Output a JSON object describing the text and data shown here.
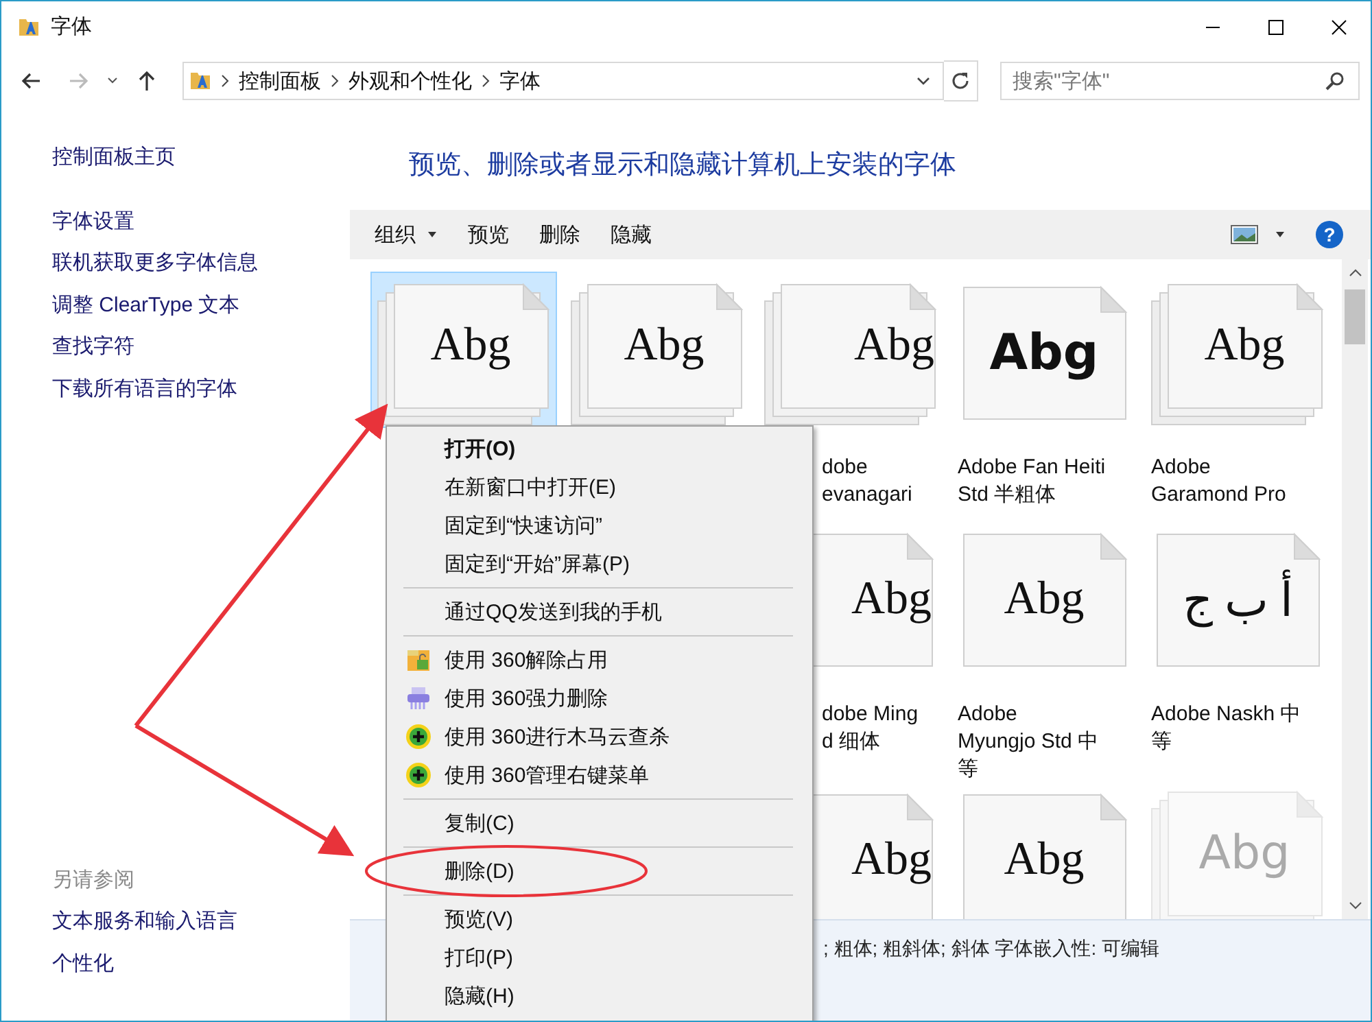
{
  "window": {
    "title": "字体"
  },
  "address": {
    "crumbs": [
      "控制面板",
      "外观和个性化",
      "字体"
    ],
    "search_placeholder": "搜索\"字体\""
  },
  "sidebar": {
    "home": "控制面板主页",
    "links": [
      "字体设置",
      "联机获取更多字体信息",
      "调整 ClearType 文本",
      "查找字符",
      "下载所有语言的字体"
    ],
    "see_also_title": "另请参阅",
    "see_also": [
      "文本服务和输入语言",
      "个性化"
    ]
  },
  "heading": "预览、删除或者显示和隐藏计算机上安装的字体",
  "toolbar": {
    "items": [
      {
        "label": "组织",
        "dropdown": true
      },
      {
        "label": "预览",
        "dropdown": false
      },
      {
        "label": "删除",
        "dropdown": false
      },
      {
        "label": "隐藏",
        "dropdown": false
      }
    ],
    "help": "?"
  },
  "rows": [
    [
      {
        "kind": "family",
        "preview": "Abg",
        "selected": true,
        "hidden": false
      },
      {
        "kind": "family",
        "preview": "Abg",
        "selected": false,
        "hidden": false
      },
      {
        "kind": "family",
        "preview": "Abg",
        "lines": [
          "dobe",
          "evanagari"
        ],
        "selected": false,
        "hidden": false
      },
      {
        "kind": "heavy",
        "preview": "Abg",
        "lines": [
          "Adobe Fan Heiti",
          "Std 半粗体"
        ],
        "selected": false,
        "hidden": false
      },
      {
        "kind": "family",
        "preview": "Abg",
        "lines": [
          "Adobe",
          "Garamond Pro"
        ],
        "selected": false,
        "hidden": false
      }
    ],
    [
      {
        "kind": "single",
        "preview": "Abg",
        "lines": [
          "dobe Ming",
          "d 细体"
        ],
        "selected": false,
        "hidden": false
      },
      {
        "kind": "single",
        "preview": "Abg",
        "lines": [
          "Adobe",
          "Myungjo Std 中",
          "等"
        ],
        "selected": false,
        "hidden": false
      },
      {
        "kind": "single",
        "preview": "أ ب ج",
        "lines": [
          "Adobe Naskh 中",
          "等"
        ],
        "selected": false,
        "hidden": false
      }
    ],
    [
      {
        "kind": "single",
        "preview": "Abg",
        "selected": false,
        "hidden": false
      },
      {
        "kind": "single",
        "preview": "Abg",
        "selected": false,
        "hidden": false
      },
      {
        "kind": "family",
        "preview": "Abg",
        "selected": false,
        "hidden": true
      }
    ]
  ],
  "details": "; 粗体; 粗斜体; 斜体 字体嵌入性: 可编辑",
  "menu": [
    {
      "kind": "item",
      "label": "打开(O)",
      "default": true,
      "circled": false
    },
    {
      "kind": "item",
      "label": "在新窗口中打开(E)",
      "default": false,
      "circled": false
    },
    {
      "kind": "item",
      "label": "固定到“快速访问”",
      "default": false,
      "circled": false
    },
    {
      "kind": "item",
      "label": "固定到“开始”屏幕(P)",
      "default": false,
      "circled": false
    },
    {
      "kind": "separator"
    },
    {
      "kind": "item",
      "label": "通过QQ发送到我的手机",
      "default": false,
      "circled": false
    },
    {
      "kind": "separator"
    },
    {
      "kind": "unlock",
      "label": "使用 360解除占用",
      "default": false,
      "circled": false
    },
    {
      "kind": "shredder",
      "label": "使用 360强力删除",
      "default": false,
      "circled": false
    },
    {
      "kind": "plus",
      "label": "使用 360进行木马云查杀",
      "default": false,
      "circled": false
    },
    {
      "kind": "plus",
      "label": "使用 360管理右键菜单",
      "default": false,
      "circled": false
    },
    {
      "kind": "separator"
    },
    {
      "kind": "item",
      "label": "复制(C)",
      "default": false,
      "circled": false
    },
    {
      "kind": "separator"
    },
    {
      "kind": "item",
      "label": "删除(D)",
      "default": false,
      "circled": true
    },
    {
      "kind": "separator"
    },
    {
      "kind": "item",
      "label": "预览(V)",
      "default": false,
      "circled": false
    },
    {
      "kind": "item",
      "label": "打印(P)",
      "default": false,
      "circled": false
    },
    {
      "kind": "item",
      "label": "隐藏(H)",
      "default": false,
      "circled": false
    }
  ]
}
